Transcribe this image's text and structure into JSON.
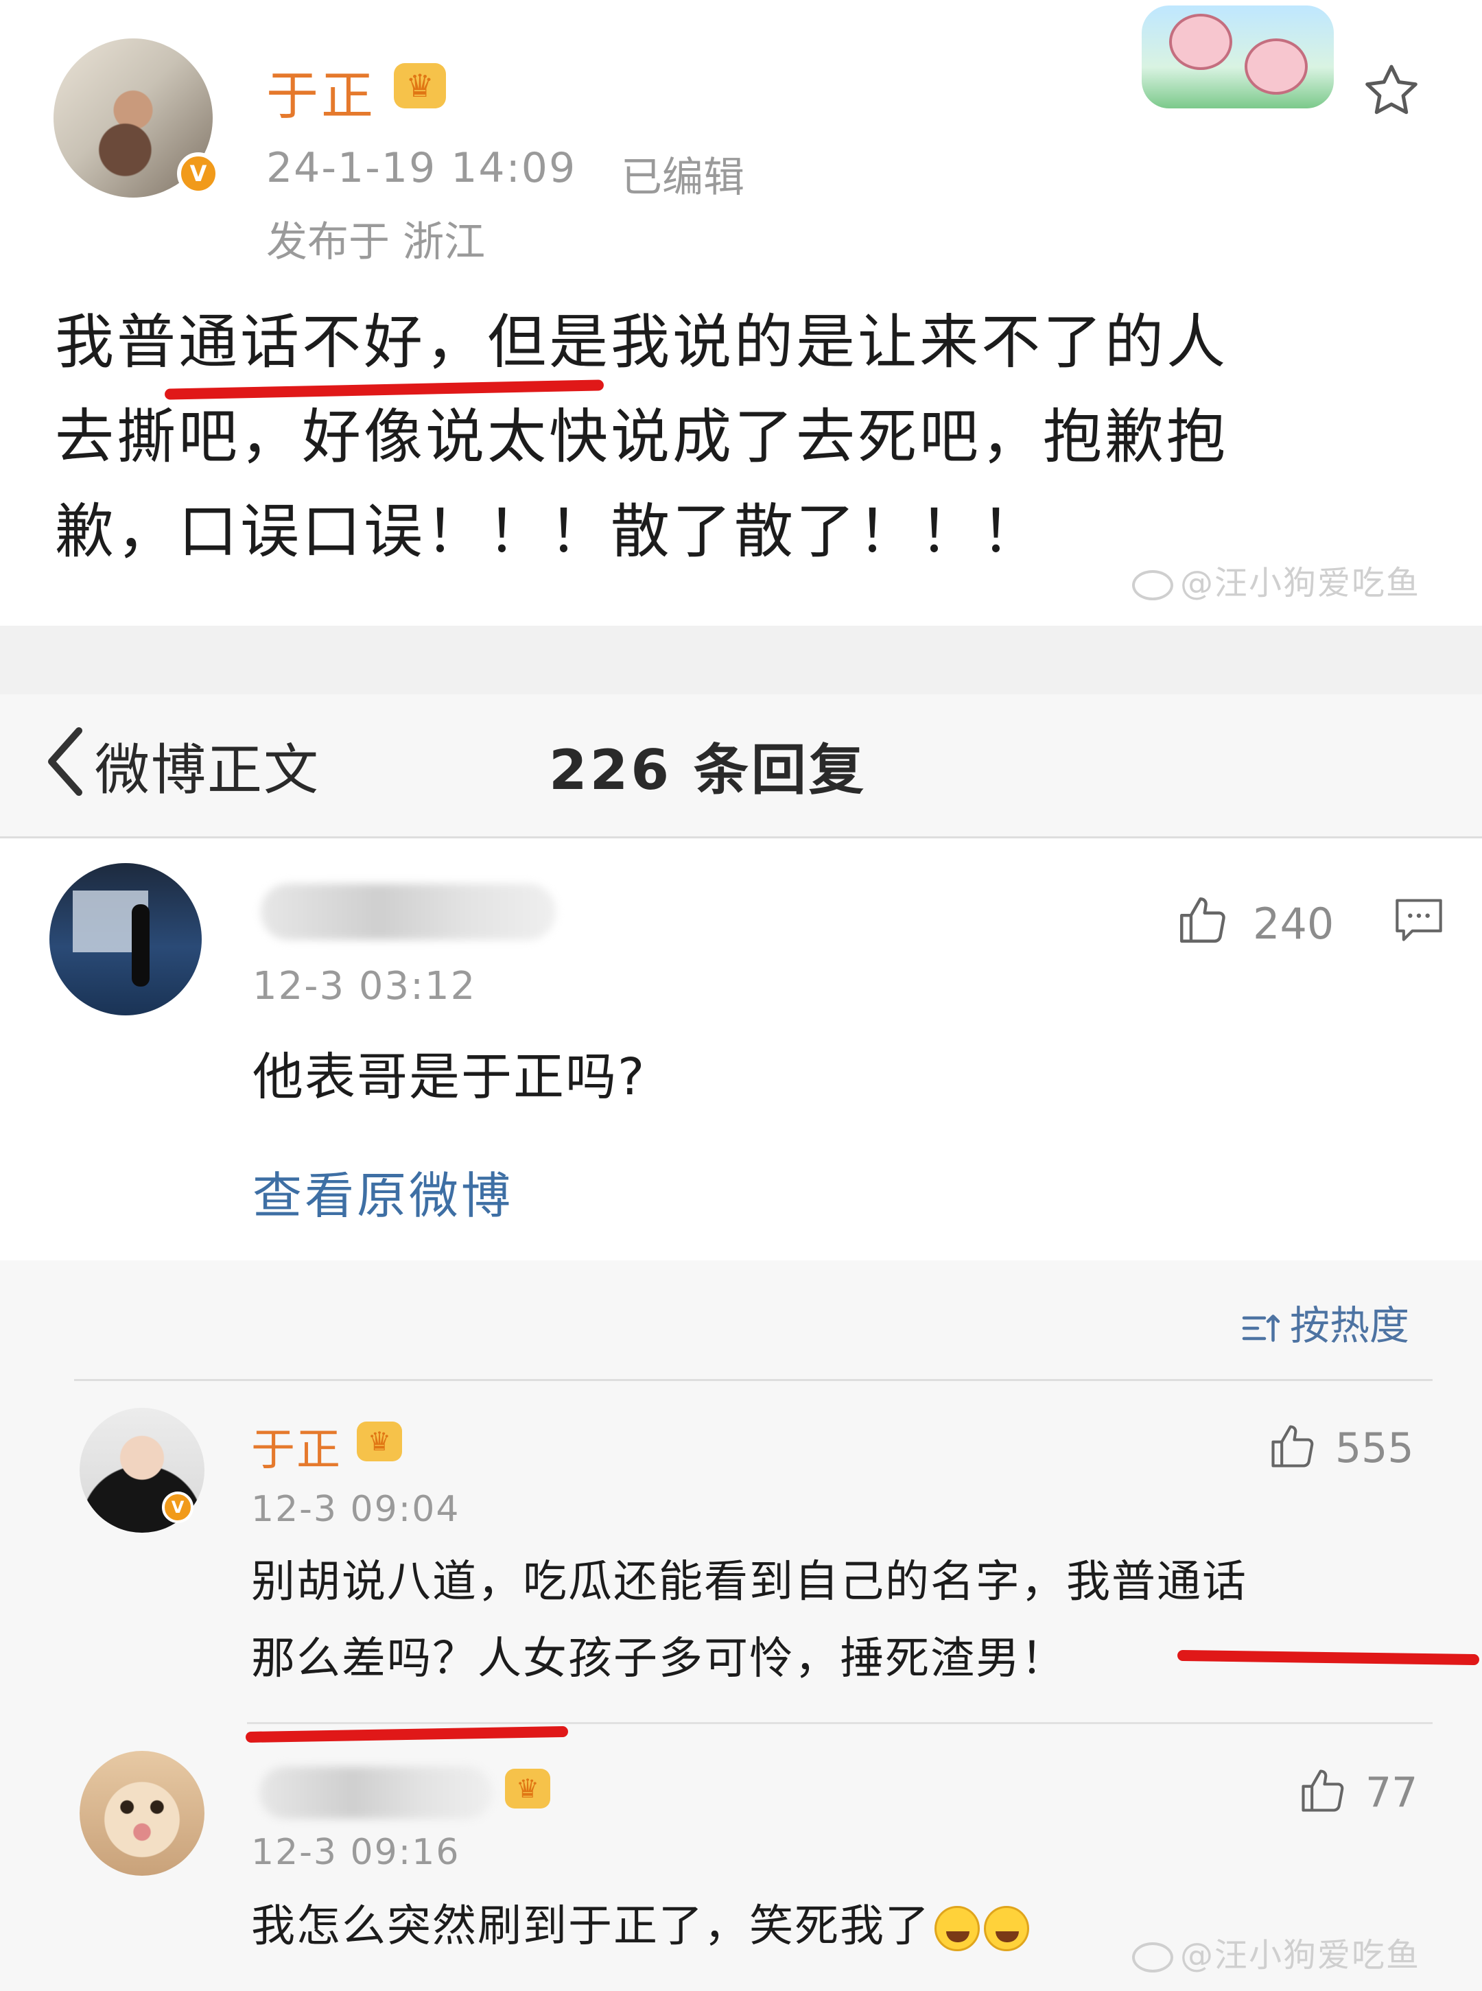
{
  "post": {
    "author": "于正",
    "time": "24-1-19 14:09",
    "edited": "已编辑",
    "location": "发布于 浙江",
    "lines": [
      "我普通话不好，但是我说的是让来不了的人",
      "去撕吧，好像说太快说成了去死吧，抱歉抱",
      "歉，口误口误！！！散了散了！！！"
    ]
  },
  "watermark": "@汪小狗爱吃鱼",
  "header": {
    "back_label": "微博正文",
    "title": "226 条回复"
  },
  "original_comment": {
    "time": "12-3 03:12",
    "text": "他表哥是于正吗?",
    "likes": "240",
    "view_original": "查看原微博"
  },
  "sort": {
    "label": "按热度"
  },
  "replies": [
    {
      "author": "于正",
      "time": "12-3 09:04",
      "likes": "555",
      "lines": [
        "别胡说八道，吃瓜还能看到自己的名字，我普通话",
        "那么差吗？人女孩子多可怜，捶死渣男！"
      ]
    },
    {
      "author": "",
      "time": "12-3 09:16",
      "likes": "77",
      "text": "我怎么突然刷到于正了，笑死我了"
    }
  ],
  "colors": {
    "author_orange": "#e5792c",
    "link_blue": "#3e6fa4",
    "highlight_red": "#e01818",
    "verified_orange": "#f19a1a"
  },
  "icons": [
    "star-icon",
    "back-chevron-icon",
    "thumbs-up-icon",
    "comment-icon",
    "sort-icon",
    "crown-icon",
    "verified-icon",
    "laughing-emoji-icon"
  ]
}
